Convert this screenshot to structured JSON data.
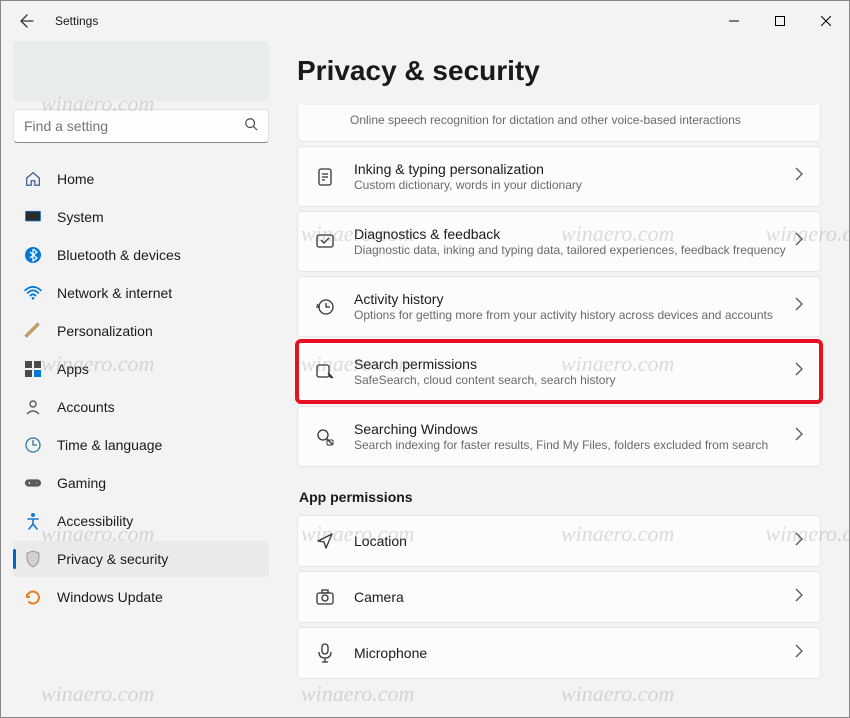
{
  "titlebar": {
    "app": "Settings"
  },
  "search": {
    "placeholder": "Find a setting"
  },
  "nav": [
    {
      "label": "Home"
    },
    {
      "label": "System"
    },
    {
      "label": "Bluetooth & devices"
    },
    {
      "label": "Network & internet"
    },
    {
      "label": "Personalization"
    },
    {
      "label": "Apps"
    },
    {
      "label": "Accounts"
    },
    {
      "label": "Time & language"
    },
    {
      "label": "Gaming"
    },
    {
      "label": "Accessibility"
    },
    {
      "label": "Privacy & security"
    },
    {
      "label": "Windows Update"
    }
  ],
  "page": {
    "title": "Privacy & security"
  },
  "partial_card": {
    "sub": "Online speech recognition for dictation and other voice-based interactions"
  },
  "cards": [
    {
      "title": "Inking & typing personalization",
      "sub": "Custom dictionary, words in your dictionary"
    },
    {
      "title": "Diagnostics & feedback",
      "sub": "Diagnostic data, inking and typing data, tailored experiences, feedback frequency"
    },
    {
      "title": "Activity history",
      "sub": "Options for getting more from your activity history across devices and accounts"
    },
    {
      "title": "Search permissions",
      "sub": "SafeSearch, cloud content search, search history"
    },
    {
      "title": "Searching Windows",
      "sub": "Search indexing for faster results, Find My Files, folders excluded from search"
    }
  ],
  "section": {
    "app_permissions": "App permissions"
  },
  "perm_cards": [
    {
      "title": "Location"
    },
    {
      "title": "Camera"
    },
    {
      "title": "Microphone"
    }
  ],
  "watermark": "winaero.com"
}
